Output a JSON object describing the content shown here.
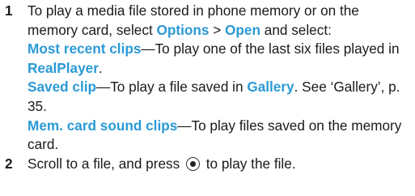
{
  "step1": {
    "number": "1",
    "intro": "To play a media file stored in phone memory or on the memory card, select ",
    "options": "Options",
    "sep": " > ",
    "open": "Open",
    "intro_end": " and select:",
    "item1_label": "Most recent clips",
    "item1_text": "—To play one of the last six files played in ",
    "item1_app": "RealPlayer",
    "item1_end": ".",
    "item2_label": "Saved clip",
    "item2_text": "—To play a file saved in ",
    "item2_app": "Gallery",
    "item2_end": ". See ‘Gallery’, p. 35.",
    "item3_label": "Mem. card sound clips",
    "item3_text": "—To play files saved on the memory card."
  },
  "step2": {
    "number": "2",
    "text_before": "Scroll to a file, and press ",
    "icon": "joystick-select-icon",
    "text_after": " to play the file."
  },
  "colors": {
    "highlight": "#2b9ad6",
    "text": "#1a1a1a"
  }
}
